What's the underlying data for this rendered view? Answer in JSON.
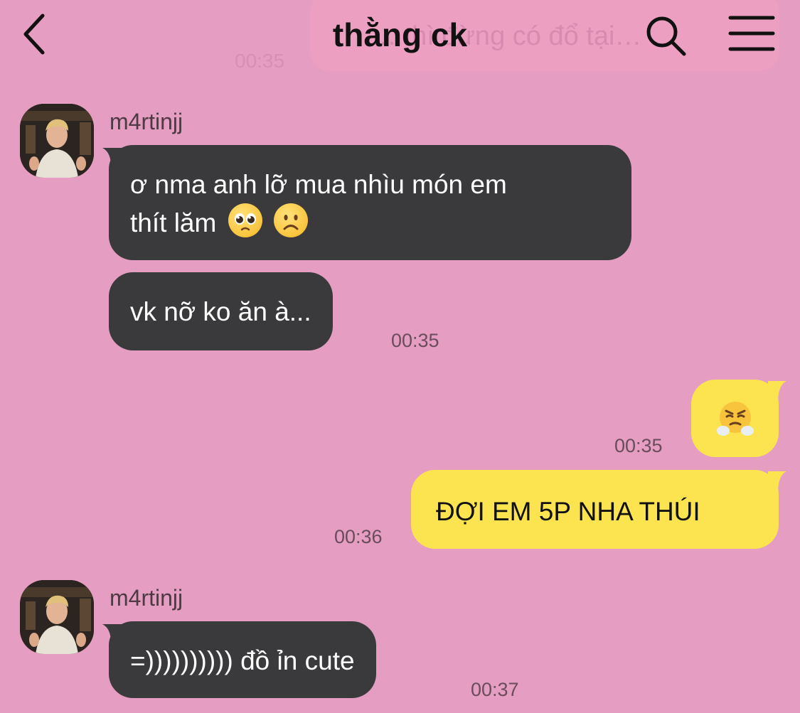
{
  "header": {
    "title": "thằng ck",
    "ghost_message": "… thì đừng có đổ tại…",
    "ghost_time": "00:35"
  },
  "messages": [
    {
      "sender": "m4rtinjj",
      "bubbles": [
        {
          "line1": "ơ nma anh lỡ mua nhìu món em",
          "line2": "thít lăm",
          "emojis": [
            "pleading-face",
            "frowning-face"
          ]
        },
        {
          "text": "vk nỡ ko ăn à...",
          "time": "00:35"
        }
      ]
    },
    {
      "sender": "me",
      "bubbles": [
        {
          "emoji": "face-with-steam-from-nose",
          "time": "00:35"
        },
        {
          "text": "ĐỢI EM 5P NHA THÚI",
          "time": "00:36"
        }
      ]
    },
    {
      "sender": "m4rtinjj",
      "bubbles": [
        {
          "text": "=)))))))))) đồ ỉn cute",
          "time": "00:37"
        }
      ]
    }
  ],
  "colors": {
    "background": "#e59ec1",
    "incoming_bubble": "#3a3a3c",
    "outgoing_bubble": "#fbe44f",
    "timestamp": "#6b4c5c"
  },
  "icons": [
    "back-arrow-icon",
    "search-icon",
    "menu-icon"
  ]
}
